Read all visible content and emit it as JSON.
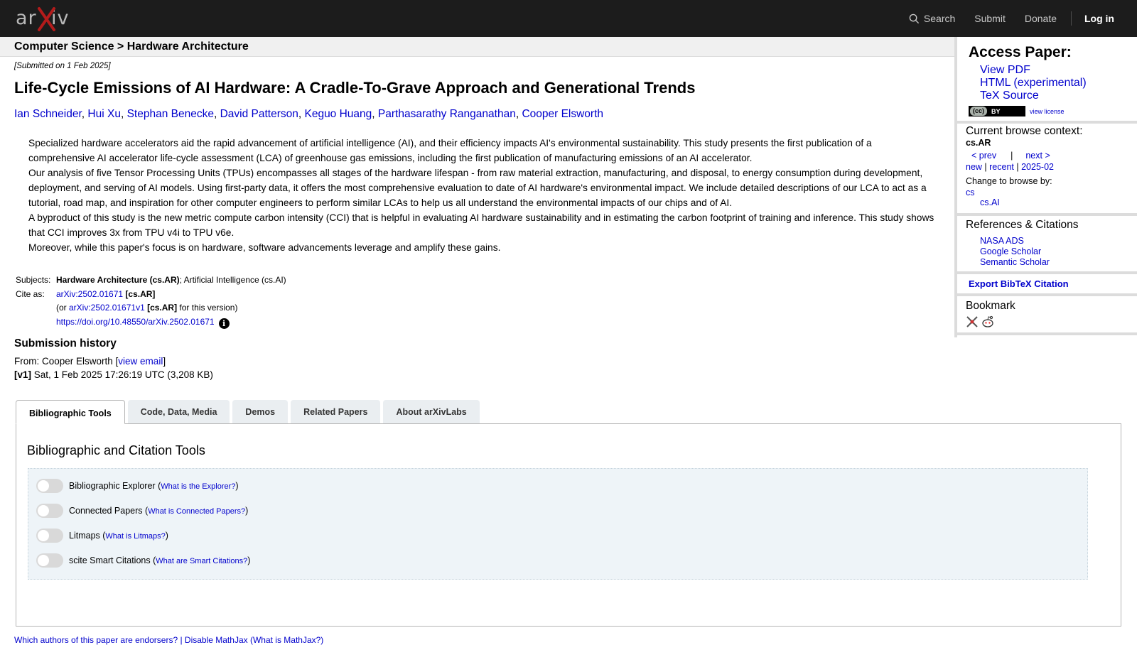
{
  "topbar": {
    "logo_text": "arXiv",
    "search": "Search",
    "submit": "Submit",
    "donate": "Donate",
    "login": "Log in"
  },
  "breadcrumb": "Computer Science > Hardware Architecture",
  "paper": {
    "submitted": "[Submitted on 1 Feb 2025]",
    "title": "Life-Cycle Emissions of AI Hardware: A Cradle-To-Grave Approach and Generational Trends",
    "authors": [
      "Ian Schneider",
      "Hui Xu",
      "Stephan Benecke",
      "David Patterson",
      "Keguo Huang",
      "Parthasarathy Ranganathan",
      "Cooper Elsworth"
    ],
    "author_sep": ", ",
    "abstract": [
      "Specialized hardware accelerators aid the rapid advancement of artificial intelligence (AI), and their efficiency impacts AI's environmental sustainability. This study presents the first publication of a comprehensive AI accelerator life-cycle assessment (LCA) of greenhouse gas emissions, including the first publication of manufacturing emissions of an AI accelerator.",
      "Our analysis of five Tensor Processing Units (TPUs) encompasses all stages of the hardware lifespan - from raw material extraction, manufacturing, and disposal, to energy consumption during development, deployment, and serving of AI models. Using first-party data, it offers the most comprehensive evaluation to date of AI hardware's environmental impact. We include detailed descriptions of our LCA to act as a tutorial, road map, and inspiration for other computer engineers to perform similar LCAs to help us all understand the environmental impacts of our chips and of AI.",
      "A byproduct of this study is the new metric compute carbon intensity (CCI) that is helpful in evaluating AI hardware sustainability and in estimating the carbon footprint of training and inference. This study shows that CCI improves 3x from TPU v4i to TPU v6e.",
      "Moreover, while this paper's focus is on hardware, software advancements leverage and amplify these gains."
    ],
    "subjects_label": "Subjects:",
    "subject_primary": "Hardware Architecture (cs.AR)",
    "subject_rest": "; Artificial Intelligence (cs.AI)",
    "cite_label": "Cite as:",
    "cite_id": "arXiv:2502.01671",
    "cite_cat": " [cs.AR]",
    "cite_version_pre": "(or ",
    "cite_version_id": "arXiv:2502.01671v1",
    "cite_version_cat": " [cs.AR]",
    "cite_version_post": " for this version)",
    "doi": "https://doi.org/10.48550/arXiv.2502.01671",
    "info_glyph": "i"
  },
  "history": {
    "title": "Submission history",
    "from_pre": "From: Cooper Elsworth [",
    "view_email": "view email",
    "from_post": "]",
    "v1_label": "[v1]",
    "v1_text": " Sat, 1 Feb 2025 17:26:19 UTC (3,208 KB)"
  },
  "sidebar": {
    "access_title": "Access Paper:",
    "access_links": [
      "View PDF",
      "HTML (experimental)",
      "TeX Source"
    ],
    "cc_left": "(cc)",
    "cc_right": "BY",
    "view_license": "view license",
    "context_title": "Current browse context:",
    "context_cat": "cs.AR",
    "prev": "< prev",
    "nav_sep": "|",
    "next": "next >",
    "new": "new",
    "recent": "recent",
    "month": "2025-02",
    "pipe": " | ",
    "change_label": "Change to browse by:",
    "cs": "cs",
    "csai": "cs.AI",
    "refs_title": "References & Citations",
    "refs_links": [
      "NASA ADS",
      "Google Scholar",
      "Semantic Scholar"
    ],
    "bibtex": "Export BibTeX Citation",
    "bookmark_title": "Bookmark"
  },
  "tabs": [
    "Bibliographic Tools",
    "Code, Data, Media",
    "Demos",
    "Related Papers",
    "About arXivLabs"
  ],
  "panel": {
    "title": "Bibliographic and Citation Tools",
    "tools": [
      {
        "name": "Bibliographic Explorer",
        "help": "What is the Explorer?"
      },
      {
        "name": "Connected Papers",
        "help": "What is Connected Papers?"
      },
      {
        "name": "Litmaps",
        "help": "What is Litmaps?"
      },
      {
        "name": "scite Smart Citations",
        "help": "What are Smart Citations?"
      }
    ]
  },
  "footer_peek": "Which authors of this paper are endorsers? | Disable MathJax (What is MathJax?)"
}
